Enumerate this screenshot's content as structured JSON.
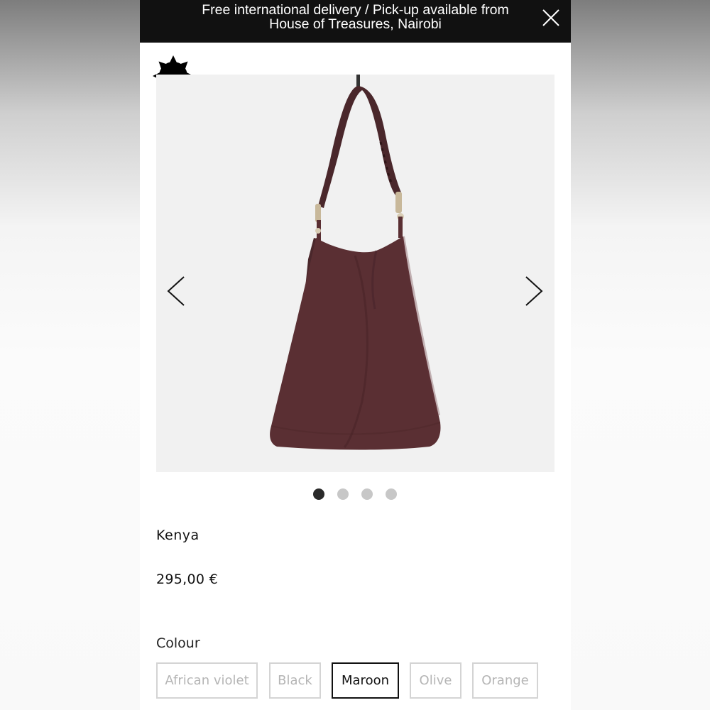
{
  "banner": {
    "line1": "Free international delivery / Pick-up available from",
    "line2": "House of Treasures, Nairobi"
  },
  "gallery": {
    "slide_count": 4,
    "active_slide": 1
  },
  "product": {
    "name": "Kenya",
    "price": "295,00 €"
  },
  "colour": {
    "label": "Colour",
    "options": [
      "African violet",
      "Black",
      "Maroon",
      "Olive",
      "Orange"
    ],
    "selected": "Maroon"
  },
  "colors": {
    "banner_bg": "#111111",
    "bag": "#5a2f33",
    "gallery_bg": "#f1f1f1"
  }
}
